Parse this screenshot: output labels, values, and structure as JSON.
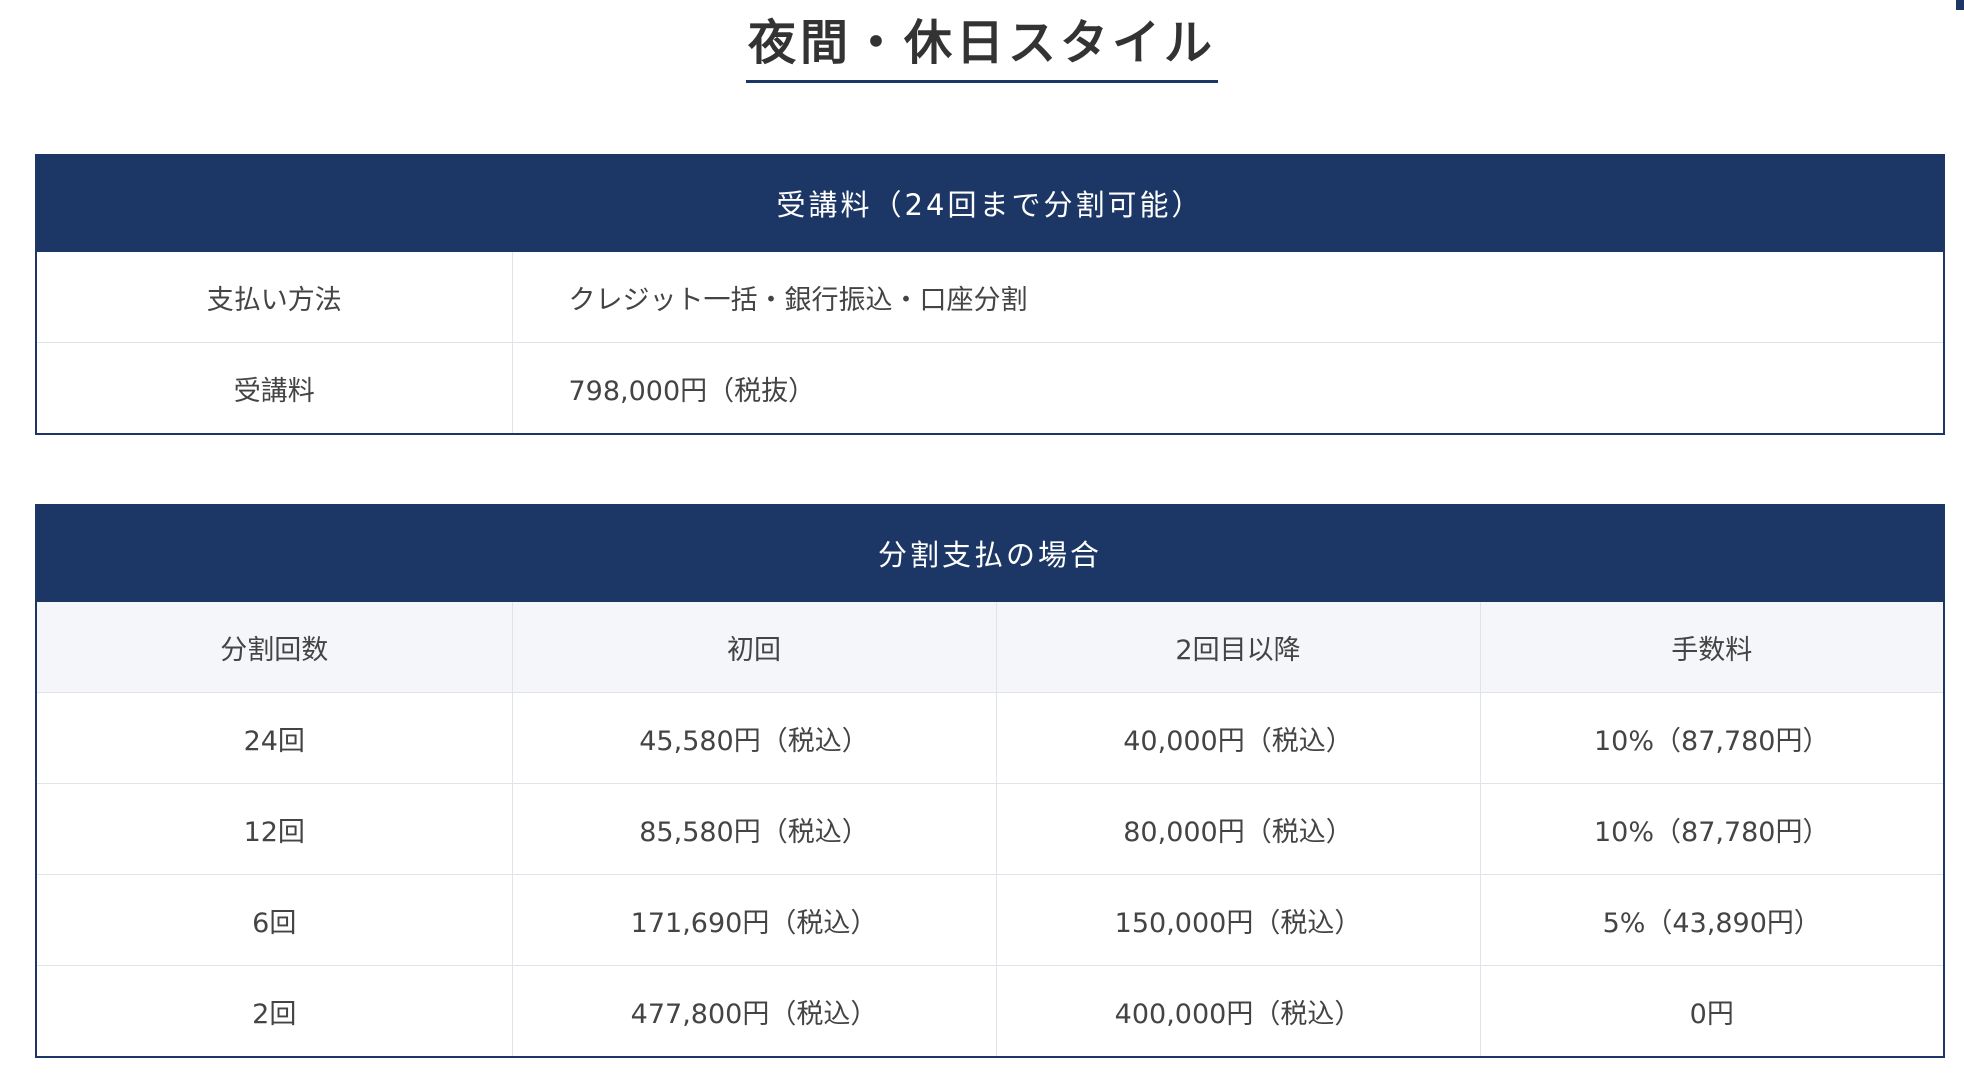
{
  "page": {
    "title": "夜間・休日スタイル"
  },
  "fee_table": {
    "header": "受講料（24回まで分割可能）",
    "rows": [
      {
        "label": "支払い方法",
        "value": "クレジット一括・銀行振込・口座分割"
      },
      {
        "label": "受講料",
        "value": "798,000円（税抜）"
      }
    ]
  },
  "installment_table": {
    "header": "分割支払の場合",
    "columns": [
      "分割回数",
      "初回",
      "2回目以降",
      "手数料"
    ],
    "rows": [
      [
        "24回",
        "45,580円（税込）",
        "40,000円（税込）",
        "10%（87,780円）"
      ],
      [
        "12回",
        "85,580円（税込）",
        "80,000円（税込）",
        "10%（87,780円）"
      ],
      [
        "6回",
        "171,690円（税込）",
        "150,000円（税込）",
        "5%（43,890円）"
      ],
      [
        "2回",
        "477,800円（税込）",
        "400,000円（税込）",
        "0円"
      ]
    ]
  },
  "colors": {
    "header_bg": "#1c3766",
    "header_text": "#ffffff",
    "column_header_bg": "#f4f6fa",
    "cell_border": "#e0e3ea",
    "text": "#333333"
  }
}
